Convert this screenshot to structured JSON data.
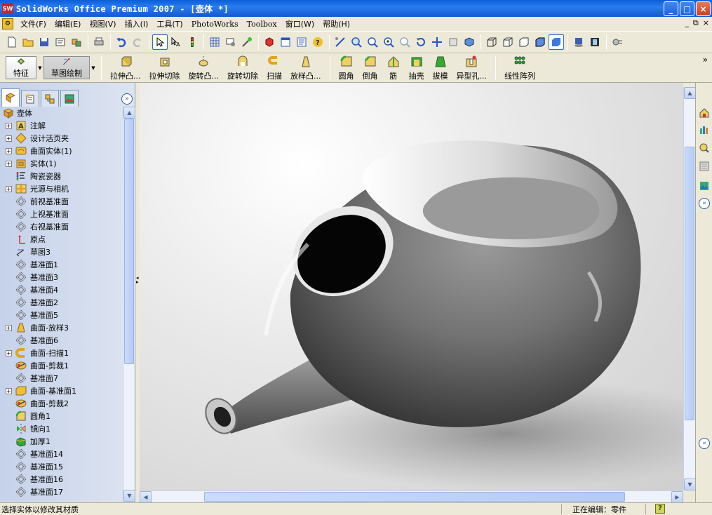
{
  "window": {
    "title": "SolidWorks Office Premium 2007 - [壶体 *]",
    "app_icon_text": "SW",
    "minimize": "_",
    "maximize": "□",
    "close": "×"
  },
  "menu": {
    "items": [
      "文件(F)",
      "编辑(E)",
      "视图(V)",
      "插入(I)",
      "工具(T)",
      "PhotoWorks",
      "Toolbox",
      "窗口(W)",
      "帮助(H)"
    ],
    "right_controls": [
      "_",
      "⧉",
      "×"
    ]
  },
  "command_manager": {
    "tabs": [
      {
        "label": "特征",
        "icon": "features-icon"
      },
      {
        "label": "草图绘制",
        "icon": "sketch-icon"
      }
    ],
    "commands": [
      "拉伸凸...",
      "拉伸切除",
      "旋转凸...",
      "旋转切除",
      "扫描",
      "放样凸...",
      "圆角",
      "倒角",
      "筋",
      "抽壳",
      "拔模",
      "异型孔...",
      "线性阵列"
    ],
    "overflow": "»"
  },
  "feature_tree": {
    "root": "壶体",
    "collapse": "»",
    "items": [
      {
        "label": "注解",
        "icon": "annotation-icon",
        "expandable": true
      },
      {
        "label": "设计活页夹",
        "icon": "design-binder-icon",
        "expandable": true
      },
      {
        "label": "曲面实体(1)",
        "icon": "surface-body-icon",
        "expandable": true
      },
      {
        "label": "实体(1)",
        "icon": "solid-body-icon",
        "expandable": true
      },
      {
        "label": "陶瓷瓷器",
        "icon": "material-icon",
        "expandable": false
      },
      {
        "label": "光源与相机",
        "icon": "lights-camera-icon",
        "expandable": true
      },
      {
        "label": "前视基准面",
        "icon": "plane-icon",
        "expandable": false
      },
      {
        "label": "上视基准面",
        "icon": "plane-icon",
        "expandable": false
      },
      {
        "label": "右视基准面",
        "icon": "plane-icon",
        "expandable": false
      },
      {
        "label": "原点",
        "icon": "origin-icon",
        "expandable": false
      },
      {
        "label": "草图3",
        "icon": "sketch-icon",
        "expandable": false
      },
      {
        "label": "基准面1",
        "icon": "plane-icon",
        "expandable": false
      },
      {
        "label": "基准面3",
        "icon": "plane-icon",
        "expandable": false
      },
      {
        "label": "基准面4",
        "icon": "plane-icon",
        "expandable": false
      },
      {
        "label": "基准面2",
        "icon": "plane-icon",
        "expandable": false
      },
      {
        "label": "基准面5",
        "icon": "plane-icon",
        "expandable": false
      },
      {
        "label": "曲面-放样3",
        "icon": "surface-loft-icon",
        "expandable": true
      },
      {
        "label": "基准面6",
        "icon": "plane-icon",
        "expandable": false
      },
      {
        "label": "曲面-扫描1",
        "icon": "surface-sweep-icon",
        "expandable": true
      },
      {
        "label": "曲面-剪裁1",
        "icon": "surface-trim-icon",
        "expandable": false
      },
      {
        "label": "基准面7",
        "icon": "plane-icon",
        "expandable": false
      },
      {
        "label": "曲面-基准面1",
        "icon": "planar-surface-icon",
        "expandable": true
      },
      {
        "label": "曲面-剪裁2",
        "icon": "surface-trim-icon",
        "expandable": false
      },
      {
        "label": "圆角1",
        "icon": "fillet-icon",
        "expandable": false
      },
      {
        "label": "镜向1",
        "icon": "mirror-icon",
        "expandable": false
      },
      {
        "label": "加厚1",
        "icon": "thicken-icon",
        "expandable": false
      },
      {
        "label": "基准面14",
        "icon": "plane-icon",
        "expandable": false
      },
      {
        "label": "基准面15",
        "icon": "plane-icon",
        "expandable": false
      },
      {
        "label": "基准面16",
        "icon": "plane-icon",
        "expandable": false
      },
      {
        "label": "基准面17",
        "icon": "plane-icon",
        "expandable": false
      }
    ]
  },
  "status": {
    "message": "选择实体以修改其材质",
    "mode": "正在编辑：零件",
    "help": "?"
  },
  "colors": {
    "titlebar": "#1458d0",
    "panel": "#c6d2ea",
    "chrome": "#ece9d8"
  }
}
